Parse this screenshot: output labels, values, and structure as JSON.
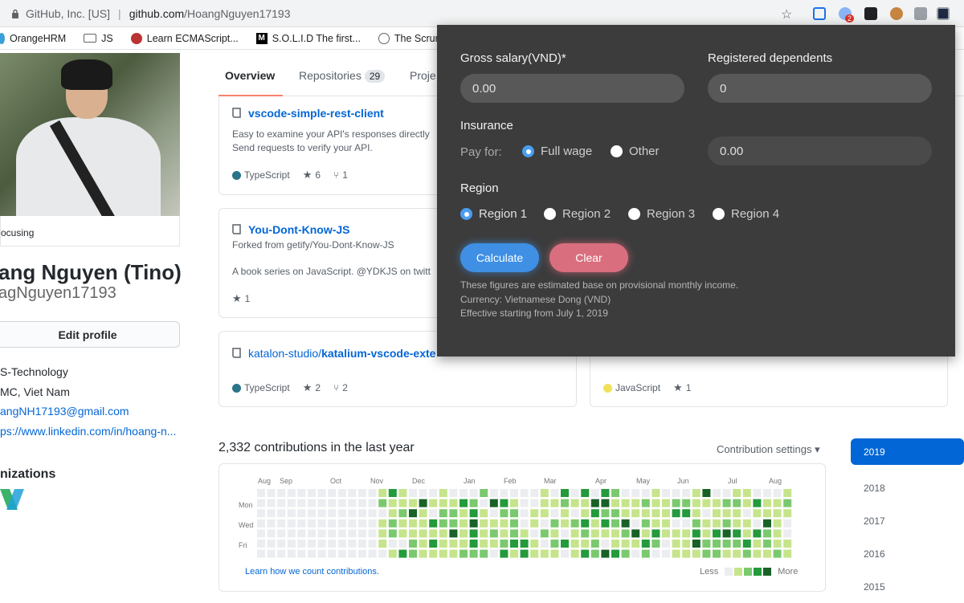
{
  "browser": {
    "site_identity": "GitHub, Inc. [US]",
    "url_host": "github.com",
    "url_path": "/HoangNguyen17193",
    "extension_badge": "2"
  },
  "bookmarks": [
    "OrangeHRM",
    "JS",
    "Learn ECMAScript...",
    "S.O.L.I.D The first...",
    "The Scrum G"
  ],
  "profile": {
    "status": "ocusing",
    "full_name": "ang Nguyen (Tino)",
    "login": "agNguyen17193",
    "edit_label": "Edit profile",
    "company": "S-Technology",
    "location": "MC, Viet Nam",
    "email": "angNH17193@gmail.com",
    "website": "ps://www.linkedin.com/in/hoang-n...",
    "orgs_heading": "nizations"
  },
  "tabs": [
    {
      "label": "Overview"
    },
    {
      "label": "Repositories",
      "count": "29"
    },
    {
      "label": "Proje"
    }
  ],
  "repos": [
    {
      "name": "vscode-simple-rest-client",
      "desc1": "Easy to examine your API's responses directly",
      "desc2": "Send requests to verify your API.",
      "lang": "TypeScript",
      "stars": "6",
      "forks": "1"
    },
    {
      "name": "You-Dont-Know-JS",
      "forked": "Forked from getify/You-Dont-Know-JS",
      "desc1": "A book series on JavaScript. @YDKJS on twitt",
      "stars": "1"
    },
    {
      "owner": "katalon-studio/",
      "name": "katalium-vscode-exte",
      "lang": "TypeScript",
      "stars": "2",
      "forks": "2"
    },
    {
      "lang": "JavaScript",
      "stars": "1"
    }
  ],
  "contributions": {
    "heading": "2,332 contributions in the last year",
    "settings": "Contribution settings ▾",
    "months": [
      "Aug",
      "Sep",
      "Oct",
      "Nov",
      "Dec",
      "Jan",
      "Feb",
      "Mar",
      "Apr",
      "May",
      "Jun",
      "Jul",
      "Aug"
    ],
    "days": [
      "Mon",
      "Wed",
      "Fri"
    ],
    "learn": "Learn how we count contributions.",
    "less": "Less",
    "more": "More",
    "colors": [
      "#ebedf0",
      "#c6e48b",
      "#7bc96f",
      "#239a3b",
      "#196127"
    ]
  },
  "years": [
    "2019",
    "2018",
    "2017",
    "2016",
    "2015"
  ],
  "calculator": {
    "gross_label": "Gross salary(VND)*",
    "gross_value": "0.00",
    "dependents_label": "Registered dependents",
    "dependents_value": "0",
    "insurance_label": "Insurance",
    "pay_for": "Pay for:",
    "full_wage": "Full wage",
    "other": "Other",
    "insurance_value": "0.00",
    "region_label": "Region",
    "regions": [
      "Region 1",
      "Region 2",
      "Region 3",
      "Region 4"
    ],
    "calculate": "Calculate",
    "clear": "Clear",
    "notes": [
      "These figures are estimated base on provisional monthly income.",
      "Currency: Vietnamese Dong (VND)",
      "Effective starting from July 1, 2019"
    ]
  }
}
